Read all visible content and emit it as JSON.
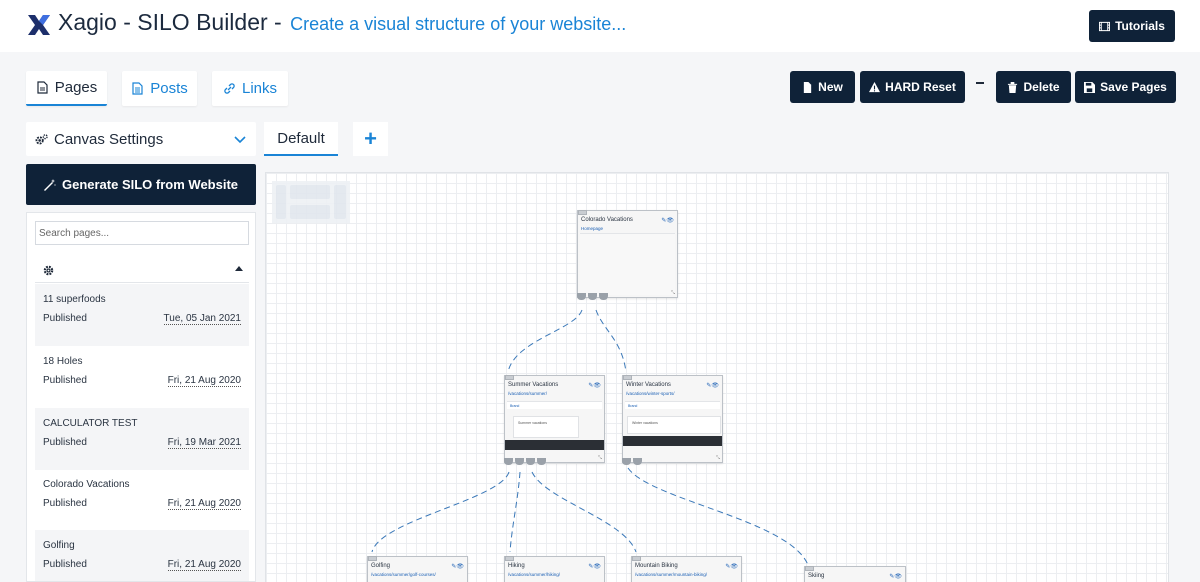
{
  "header": {
    "app_name": "Xagio - SILO Builder - ",
    "subtitle": "Create a visual structure of your website...",
    "tutorials_label": "Tutorials"
  },
  "tabs": [
    {
      "label": "Pages",
      "icon": "file-icon",
      "active": true
    },
    {
      "label": "Posts",
      "icon": "document-icon",
      "active": false
    },
    {
      "label": "Links",
      "icon": "link-icon",
      "active": false
    }
  ],
  "toolbar": {
    "new_label": "New",
    "hard_reset_label": "HARD Reset",
    "delete_label": "Delete",
    "save_label": "Save Pages"
  },
  "canvas_settings": {
    "label": "Canvas Settings",
    "default_tab": "Default",
    "add_tab": "+"
  },
  "sidebar": {
    "generate_label": "Generate SILO from Website",
    "search_placeholder": "Search pages...",
    "items": [
      {
        "name": "11 superfoods",
        "status": "Published",
        "date": "Tue, 05 Jan 2021"
      },
      {
        "name": "18 Holes",
        "status": "Published",
        "date": "Fri, 21 Aug 2020"
      },
      {
        "name": "CALCULATOR TEST",
        "status": "Published",
        "date": "Fri, 19 Mar 2021"
      },
      {
        "name": "Colorado Vacations",
        "status": "Published",
        "date": "Fri, 21 Aug 2020"
      },
      {
        "name": "Golfing",
        "status": "Published",
        "date": "Fri, 21 Aug 2020"
      }
    ]
  },
  "nodes": [
    {
      "title": "Colorado Vacations",
      "url": "Homepage"
    },
    {
      "title": "Summer Vacations",
      "url": "/vacations/summer/",
      "brand": "Brand",
      "content": "Summer vacations"
    },
    {
      "title": "Winter Vacations",
      "url": "/vacations/winter-sports/",
      "brand": "Brand",
      "content": "Winter vacations"
    },
    {
      "title": "Golfing",
      "url": "/vacations/summer/golf-courses/"
    },
    {
      "title": "Hiking",
      "url": "/vacations/summer/hiking/"
    },
    {
      "title": "Mountain Biking",
      "url": "/vacations/summer/mountain-biking/"
    },
    {
      "title": "Skiing",
      "url": ""
    }
  ],
  "colors": {
    "dark": "#0f2238",
    "accent": "#1a84d6",
    "link_line": "#3a78b8"
  }
}
